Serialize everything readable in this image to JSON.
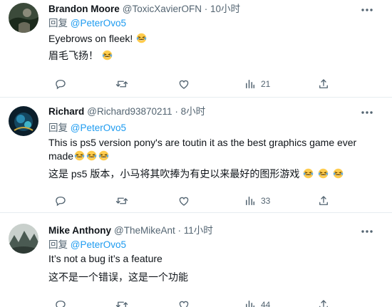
{
  "tweets": [
    {
      "name": "Brandon Moore",
      "handle": "@ToxicXavierOFN",
      "dot": "·",
      "time": "10小时",
      "reply_prefix": "回复",
      "reply_to": "@PeterOvo5",
      "lines": [
        "Eyebrows on fleek!",
        "眉毛飞扬！"
      ],
      "views": "21",
      "avatar_colors": [
        "#2a3a2a",
        "#8a8a7a"
      ]
    },
    {
      "name": "Richard",
      "handle": "@Richard93870211",
      "dot": "·",
      "time": "8小时",
      "reply_prefix": "回复",
      "reply_to": "@PeterOvo5",
      "lines": [
        "This is ps5 version pony's are toutin it as the best graphics game ever",
        "made",
        "这是 ps5 版本，小马将其吹捧为有史以来最好的图形游戏"
      ],
      "views": "33",
      "avatar_colors": [
        "#0d2a3a",
        "#2a8ab0"
      ]
    },
    {
      "name": "Mike Anthony",
      "handle": "@TheMikeAnt",
      "dot": "·",
      "time": "11小时",
      "reply_prefix": "回复",
      "reply_to": "@PeterOvo5",
      "lines": [
        "It’s not a bug it’s a feature",
        "这不是一个错误，这是一个功能"
      ],
      "views": "44",
      "avatar_colors": [
        "#b8c0bc",
        "#4a5a52"
      ]
    }
  ],
  "colors": {
    "link": "#1d9bf0",
    "secondary": "#536471",
    "text": "#0f1419",
    "divider": "#e6ecf0"
  },
  "icons": [
    "more-icon",
    "reply-icon",
    "retweet-icon",
    "like-icon",
    "views-icon",
    "share-icon",
    "laughing-emoji-icon"
  ]
}
